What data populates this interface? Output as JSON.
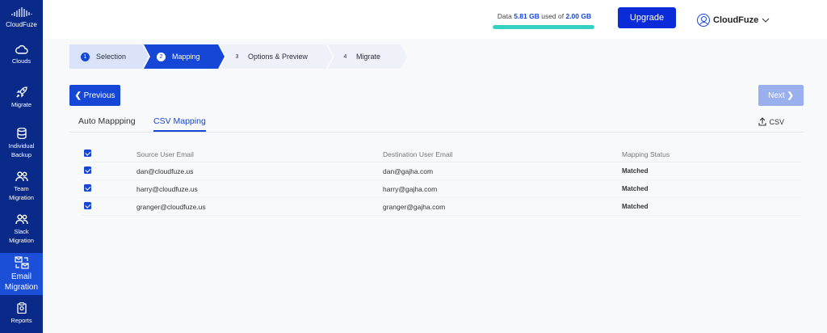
{
  "brand": {
    "name": "CloudFuze",
    "icon": "cloudfuze-logo"
  },
  "sidebar": {
    "items": [
      {
        "label": "Clouds",
        "icon": "cloud-icon"
      },
      {
        "label": "Migrate",
        "icon": "rocket-icon"
      },
      {
        "label": "Individual\nBackup",
        "icon": "database-icon"
      },
      {
        "label": "Team\nMigration",
        "icon": "users-icon"
      },
      {
        "label": "Slack\nMigration",
        "icon": "users-icon"
      },
      {
        "label": "Email\nMigration",
        "icon": "mail-swap-icon",
        "active": true
      },
      {
        "label": "Reports",
        "icon": "clipboard-icon"
      }
    ]
  },
  "header": {
    "usage_prefix": "Data ",
    "usage_used": "5.81 GB",
    "usage_mid": " used of ",
    "usage_total": "2.00 GB",
    "usage_fraction": 1.0,
    "upgrade_label": "Upgrade",
    "account_name": "CloudFuze"
  },
  "stepper": {
    "steps": [
      {
        "num": "1",
        "label": "Selection",
        "state": "done"
      },
      {
        "num": "2",
        "label": "Mapping",
        "state": "current"
      },
      {
        "num": "3",
        "label": "Options & Preview",
        "state": "todo"
      },
      {
        "num": "4",
        "label": "Migrate",
        "state": "todo"
      }
    ]
  },
  "nav_buttons": {
    "previous": "Previous",
    "next": "Next"
  },
  "tabs": [
    {
      "label": "Auto Mappping",
      "active": false
    },
    {
      "label": "CSV Mapping",
      "active": true
    }
  ],
  "csv_label": "CSV",
  "table": {
    "columns": [
      "Source User Email",
      "Destination User Email",
      "Mapping Status"
    ],
    "rows": [
      {
        "source": "dan@cloudfuze.us",
        "destination": "dan@gajha.com",
        "status": "Matched",
        "checked": true
      },
      {
        "source": "harry@cloudfuze.us",
        "destination": "harry@gajha.com",
        "status": "Matched",
        "checked": true
      },
      {
        "source": "granger@cloudfuze.us",
        "destination": "granger@gajha.com",
        "status": "Matched",
        "checked": true
      }
    ]
  },
  "colors": {
    "sidebar": "#0a2a8a",
    "accent": "#1546d6",
    "usage_bar": "#35d2c4"
  }
}
